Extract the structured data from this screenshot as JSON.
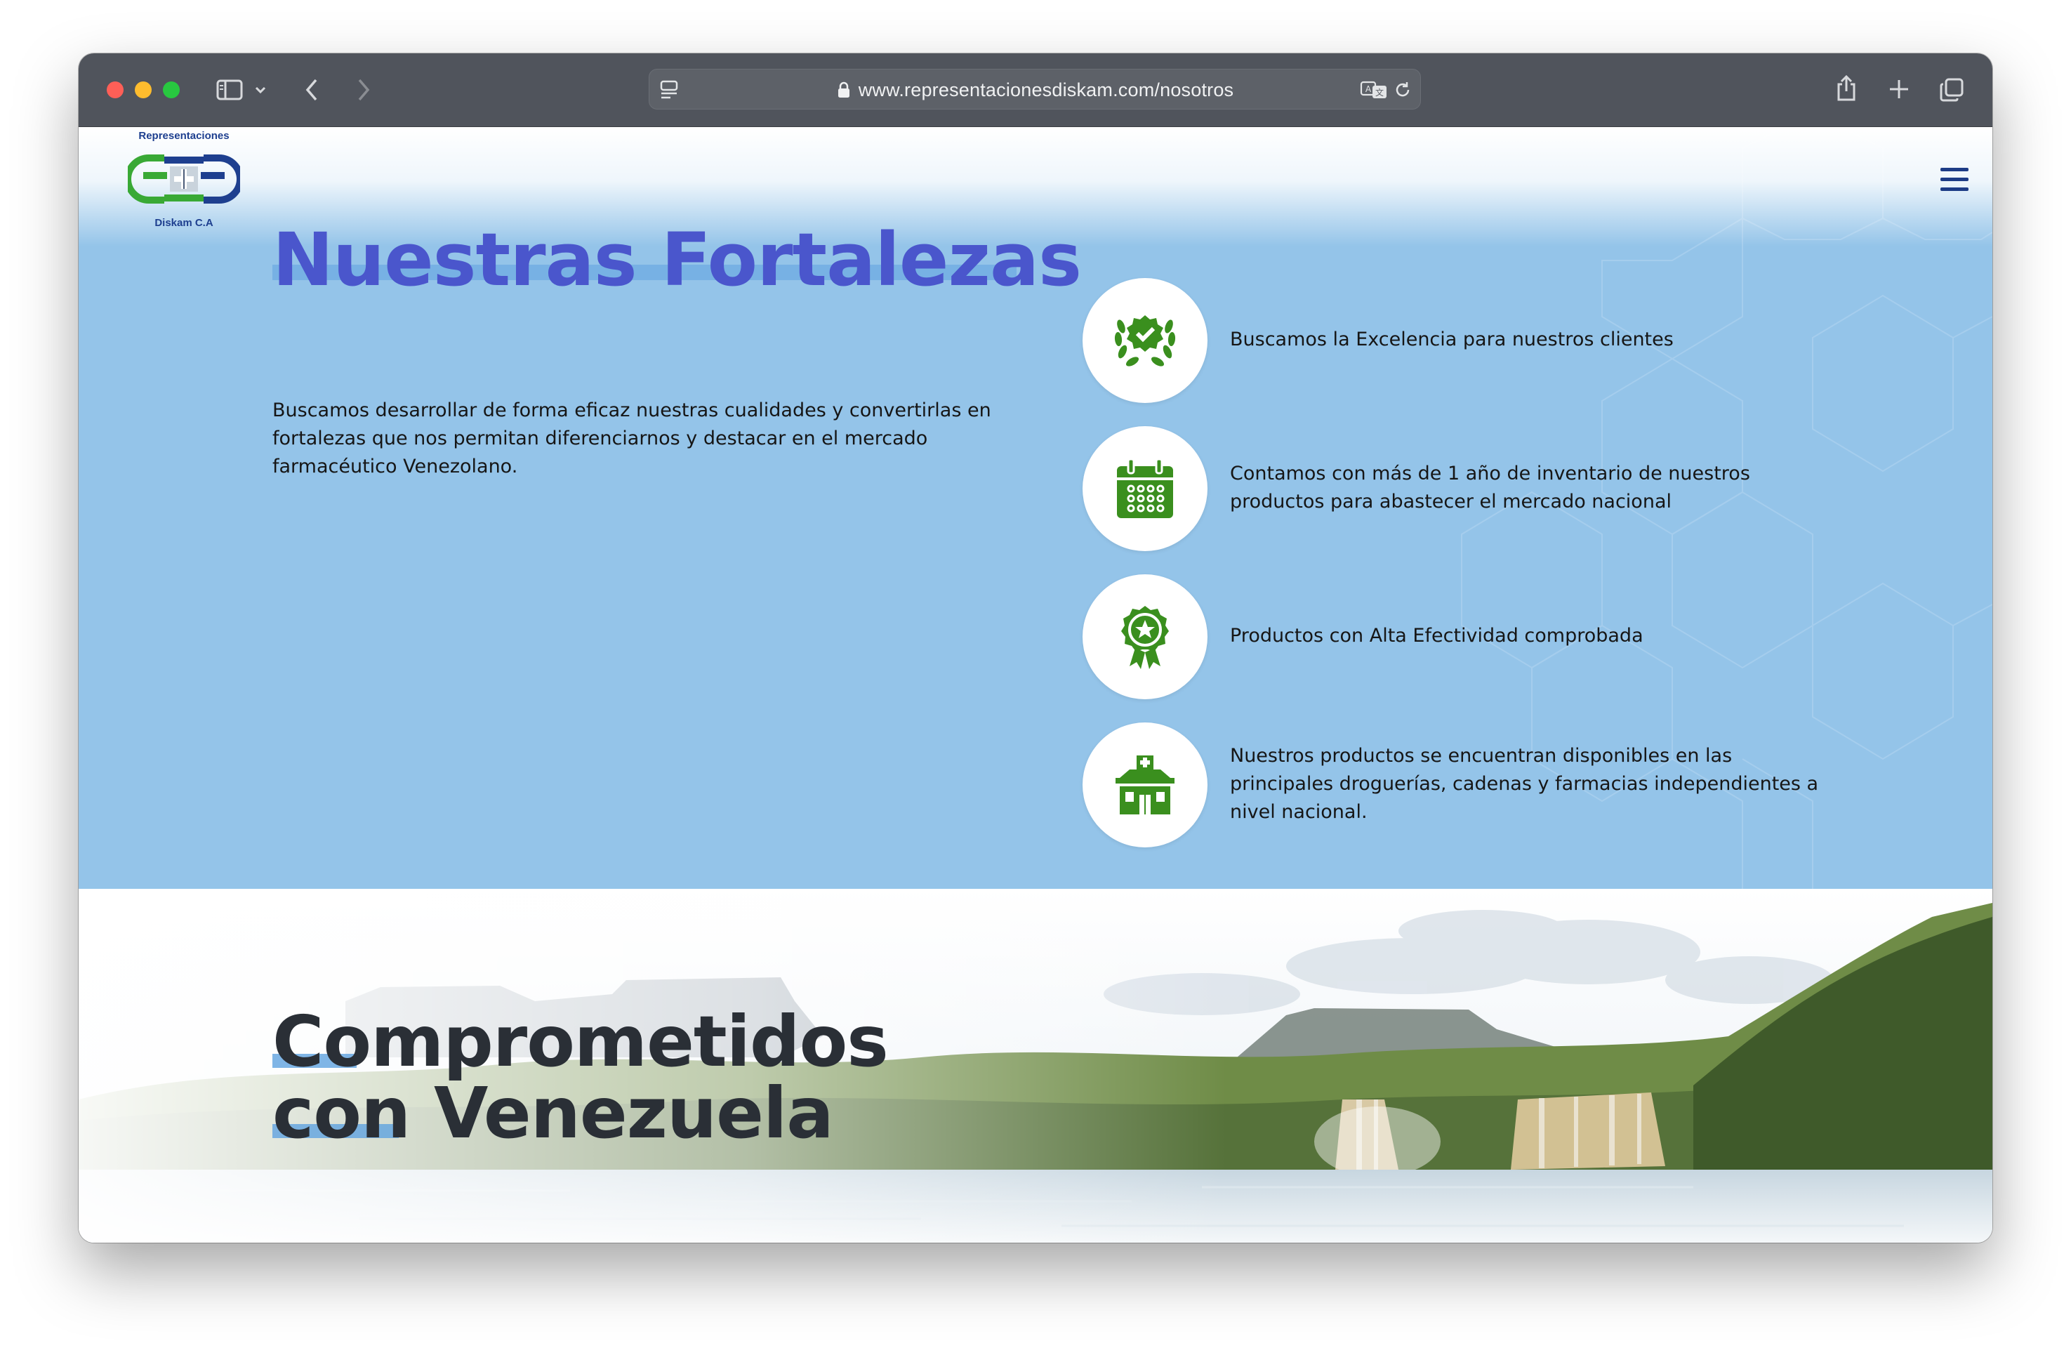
{
  "browser": {
    "url": "www.representacionesdiskam.com/nosotros"
  },
  "logo": {
    "top_text": "Representaciones",
    "bottom_text": "Diskam C.A"
  },
  "fortalezas": {
    "title": "Nuestras Fortalezas",
    "description": "Buscamos desarrollar de forma eficaz nuestras cualidades y convertirlas en fortalezas que nos permitan diferenciarnos y destacar en el mercado farmacéutico Venezolano.",
    "items": [
      {
        "icon": "laurel-check-badge-icon",
        "text": "Buscamos la Excelencia para nuestros clientes"
      },
      {
        "icon": "calendar-icon",
        "text": "Contamos con más de 1 año de inventario de nuestros productos para abastecer el mercado nacional"
      },
      {
        "icon": "star-award-icon",
        "text": "Productos con Alta Efectividad comprobada"
      },
      {
        "icon": "pharmacy-building-icon",
        "text": "Nuestros productos se encuentran disponibles en las principales droguerías, cadenas y farmacias independientes a nivel nacional."
      }
    ]
  },
  "comprometidos": {
    "line1": "Comprometidos",
    "line2": "con Venezuela"
  },
  "colors": {
    "section_bg": "#94c4e9",
    "title_blue": "#4a56cc",
    "icon_green": "#3a8f1e",
    "logo_blue": "#1e3f8f",
    "logo_green": "#39a935"
  }
}
